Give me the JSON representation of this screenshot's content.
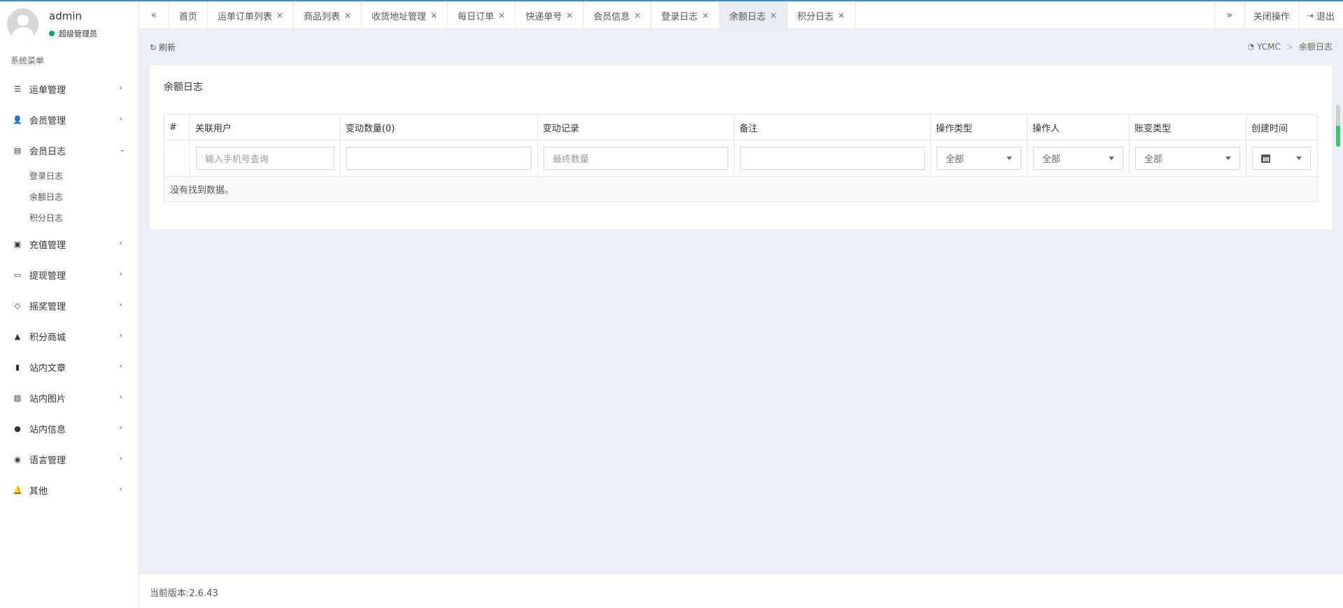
{
  "user": {
    "name": "admin",
    "role": "超级管理员"
  },
  "sidebar": {
    "header": "系统菜单",
    "items": [
      {
        "label": "运单管理"
      },
      {
        "label": "会员管理"
      },
      {
        "label": "会员日志",
        "sub": [
          "登录日志",
          "余额日志",
          "积分日志"
        ]
      },
      {
        "label": "充值管理"
      },
      {
        "label": "提现管理"
      },
      {
        "label": "摇奖管理"
      },
      {
        "label": "积分商城"
      },
      {
        "label": "站内文章"
      },
      {
        "label": "站内图片"
      },
      {
        "label": "站内信息"
      },
      {
        "label": "语言管理"
      },
      {
        "label": "其他"
      }
    ]
  },
  "tabs": {
    "prev": "«",
    "items": [
      "首页",
      "运单订单列表",
      "商品列表",
      "收货地址管理",
      "每日订单",
      "快递单号",
      "会员信息",
      "登录日志",
      "余额日志",
      "积分日志"
    ],
    "close": "×",
    "next": "»",
    "close_ops": "关闭操作",
    "logout": "退出"
  },
  "toolbar": {
    "refresh": "刷新"
  },
  "breadcrumb": {
    "home": "YCMC",
    "sep": ">",
    "current": "余额日志"
  },
  "panel": {
    "title": "余额日志",
    "columns": [
      "#",
      "关联用户",
      "变动数量(0)",
      "变动记录",
      "备注",
      "操作类型",
      "操作人",
      "账变类型",
      "创建时间"
    ],
    "filters": {
      "user_placeholder": "输入手机号查询",
      "record_placeholder": "最终数量",
      "op_type": "全部",
      "operator": "全部",
      "change_type": "全部"
    },
    "empty": "没有找到数据。"
  },
  "footer": {
    "version_label": "当前版本:",
    "version": "2.6.43"
  }
}
